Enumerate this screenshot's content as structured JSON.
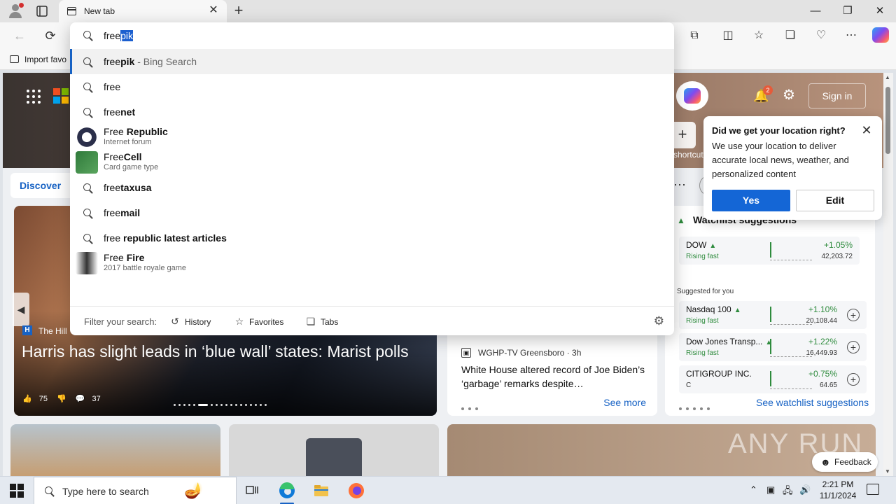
{
  "browser": {
    "tab": {
      "title": "New tab"
    },
    "toolbar": {
      "back_icon": "←",
      "refresh_icon": "⟳"
    },
    "bookmarks": {
      "import_label": "Import favo"
    }
  },
  "omnibox": {
    "query_typed": "free",
    "query_autocomplete": "pik",
    "suggestions": [
      {
        "kind": "search",
        "prefix": "free",
        "bold": "pik",
        "hint": " - Bing Search"
      },
      {
        "kind": "search",
        "prefix": "free",
        "bold": "",
        "hint": ""
      },
      {
        "kind": "search",
        "prefix": "free",
        "bold": "net",
        "hint": ""
      },
      {
        "kind": "entity",
        "prefix": "Free ",
        "bold": "Republic",
        "subtitle": "Internet forum"
      },
      {
        "kind": "entity",
        "prefix": "Free",
        "bold": "Cell",
        "subtitle": "Card game type"
      },
      {
        "kind": "search",
        "prefix": "free",
        "bold": "taxusa",
        "hint": ""
      },
      {
        "kind": "search",
        "prefix": "free",
        "bold": "mail",
        "hint": ""
      },
      {
        "kind": "search",
        "prefix": "free ",
        "bold": "republic latest articles",
        "hint": ""
      },
      {
        "kind": "entity",
        "prefix": "Free ",
        "bold": "Fire",
        "subtitle": "2017 battle royale game"
      }
    ],
    "filter": {
      "label": "Filter your search:",
      "history": "History",
      "favorites": "Favorites",
      "tabs": "Tabs"
    }
  },
  "newtab": {
    "bell_badge": "2",
    "signin_label": "Sign in",
    "shortcut_label": "shortcut",
    "discover_label": "Discover",
    "location_popup": {
      "title": "Did we get your location right?",
      "body": "We use your location to deliver accurate local news, weather, and personalized content",
      "yes_label": "Yes",
      "edit_label": "Edit"
    },
    "main_story": {
      "source_logo": "H",
      "source": "The Hill",
      "headline": "Harris has slight leads in ‘blue wall’ states: Marist polls",
      "likes": "75",
      "comments": "37"
    },
    "side_story": {
      "source": "WGHP-TV Greensboro · 3h",
      "title": "White House altered record of Joe Biden’s ‘garbage’ remarks despite…",
      "see_more": "See more"
    },
    "watchlist": {
      "heading": "Watchlist suggestions",
      "suggested_label": "Suggested for you",
      "see_link": "See watchlist suggestions",
      "stocks": [
        {
          "name": "DOW",
          "sub": "Rising fast",
          "pct": "+1.05%",
          "price": "42,203.72",
          "plus": false
        },
        {
          "name": "Nasdaq 100",
          "sub": "Rising fast",
          "pct": "+1.10%",
          "price": "20,108.44",
          "plus": true
        },
        {
          "name": "Dow Jones Transp...",
          "sub": "Rising fast",
          "pct": "+1.22%",
          "price": "16,449.93",
          "plus": true
        },
        {
          "name": "CITIGROUP INC.",
          "sub": "C",
          "pct": "+0.75%",
          "price": "64.65",
          "plus": true
        }
      ]
    },
    "feedback_label": "Feedback",
    "watermark": "ANY RUN"
  },
  "taskbar": {
    "search_placeholder": "Type here to search",
    "time": "2:21 PM",
    "date": "11/1/2024"
  },
  "colors": {
    "accent": "#1762c4",
    "selection": "#1b5fcf",
    "rising": "#2e8b3d",
    "badge": "#e55b3a"
  }
}
